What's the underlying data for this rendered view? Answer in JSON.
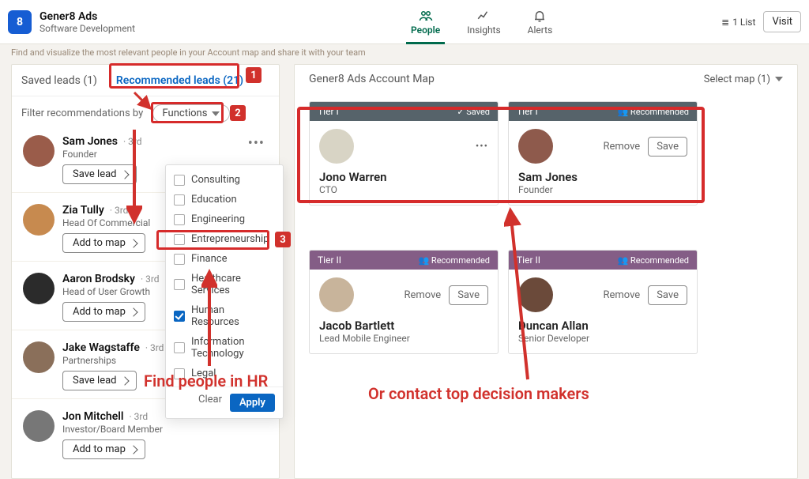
{
  "header": {
    "logo_text": "8",
    "company": "Gener8 Ads",
    "category": "Software Development",
    "nav": [
      "People",
      "Insights",
      "Alerts"
    ],
    "list_label": "1 List",
    "visit": "Visit"
  },
  "substrip": "Find and visualize the most relevant people in your Account map and share it with your team",
  "tabs": {
    "saved": "Saved leads (1)",
    "recommended": "Recommended leads (21)"
  },
  "filter": {
    "label": "Filter recommendations by",
    "pill": "Functions",
    "options": [
      {
        "label": "Consulting",
        "checked": false
      },
      {
        "label": "Education",
        "checked": false
      },
      {
        "label": "Engineering",
        "checked": false
      },
      {
        "label": "Entrepreneurship",
        "checked": false
      },
      {
        "label": "Finance",
        "checked": false
      },
      {
        "label": "Healthcare Services",
        "checked": false
      },
      {
        "label": "Human Resources",
        "checked": true
      },
      {
        "label": "Information Technology",
        "checked": false
      },
      {
        "label": "Legal",
        "checked": false
      }
    ],
    "clear": "Clear",
    "apply": "Apply"
  },
  "leads": [
    {
      "name": "Sam Jones",
      "conn": "3rd",
      "role": "Founder",
      "btn": "Save lead"
    },
    {
      "name": "Zia Tully",
      "conn": "3rd",
      "role": "Head Of Commercial",
      "btn": "Add to map"
    },
    {
      "name": "Aaron Brodsky",
      "conn": "3rd",
      "role": "Head of User Growth",
      "btn": "Add to map"
    },
    {
      "name": "Jake Wagstaffe",
      "conn": "3rd",
      "role": "Partnerships",
      "btn": "Save lead"
    },
    {
      "name": "Jon Mitchell",
      "conn": "3rd",
      "role": "Investor/Board Member",
      "btn": "Add to map"
    }
  ],
  "map": {
    "title": "Gener8 Ads Account Map",
    "selector": "Select map (1)",
    "tiers": {
      "t1": "Tier I",
      "t2": "Tier II"
    },
    "tags": {
      "saved": "Saved",
      "recommended": "Recommended"
    },
    "actions": {
      "remove": "Remove",
      "save": "Save"
    },
    "cards_t1": [
      {
        "name": "Jono Warren",
        "role": "CTO",
        "tag": "saved"
      },
      {
        "name": "Sam Jones",
        "role": "Founder",
        "tag": "recommended"
      }
    ],
    "cards_t2": [
      {
        "name": "Jacob Bartlett",
        "role": "Lead Mobile Engineer",
        "tag": "recommended"
      },
      {
        "name": "Duncan Allan",
        "role": "Senior Developer",
        "tag": "recommended"
      }
    ]
  },
  "annot": {
    "b1": "1",
    "b2": "2",
    "b3": "3",
    "txt1": "Find people in HR",
    "txt2": "Or contact top decision makers"
  },
  "avatar_bg": [
    "#9a5c4a",
    "#c78a4f",
    "#2b2b2b",
    "#8a6f5a",
    "#777"
  ],
  "card_av": [
    "#d8d4c5",
    "#8e5a4c",
    "#c8b49b",
    "#6b4a3a"
  ]
}
